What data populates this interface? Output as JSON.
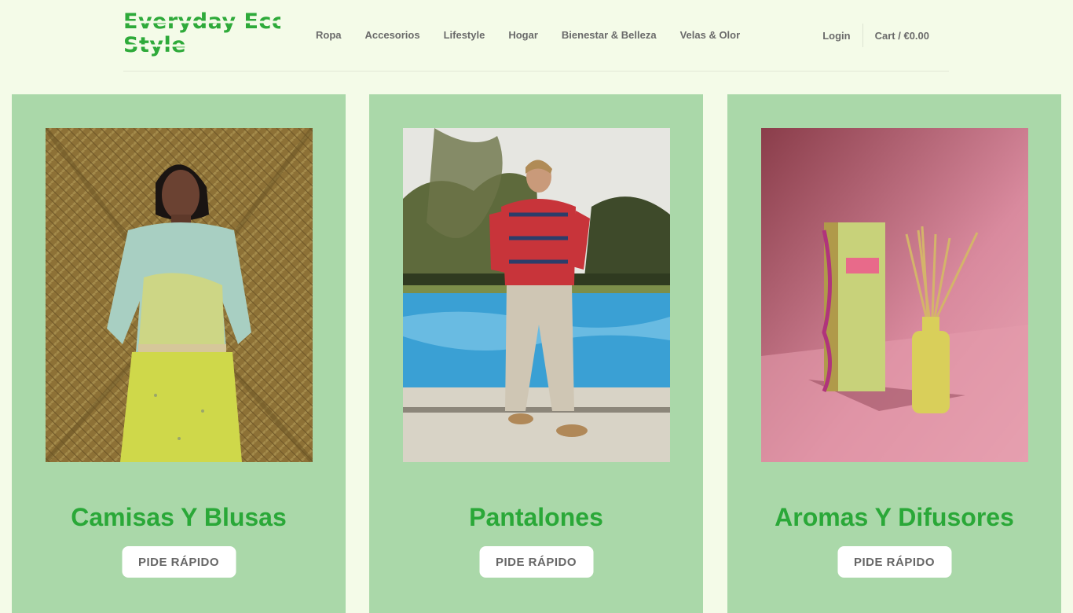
{
  "header": {
    "logo_line1": "Everyday Eco",
    "logo_line2": "Style",
    "nav": [
      "Ropa",
      "Accesorios",
      "Lifestyle",
      "Hogar",
      "Bienestar & Belleza",
      "Velas & Olor"
    ],
    "login": "Login",
    "cart": "Cart / €0.00"
  },
  "cards": [
    {
      "title": "Camisas Y Blusas",
      "button": "PIDE RÁPIDO"
    },
    {
      "title": "Pantalones",
      "button": "PIDE RÁPIDO"
    },
    {
      "title": "Aromas Y Difusores",
      "button": "PIDE RÁPIDO"
    }
  ],
  "colors": {
    "page_bg": "#f4fbe8",
    "card_bg": "#aad8a9",
    "accent": "#2aa838"
  }
}
